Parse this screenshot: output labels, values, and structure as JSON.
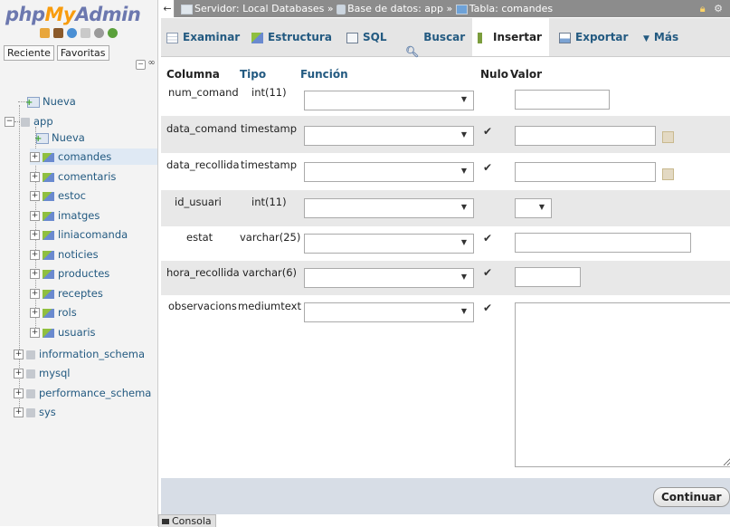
{
  "app": {
    "logo_php": "php",
    "logo_my": "My",
    "logo_admin": "Admin"
  },
  "sidebar": {
    "recent_tab": "Reciente",
    "favorites_tab": "Favoritas",
    "new_root": "Nueva",
    "databases": [
      {
        "name": "app",
        "expanded": true
      },
      {
        "name": "information_schema",
        "expanded": false
      },
      {
        "name": "mysql",
        "expanded": false
      },
      {
        "name": "performance_schema",
        "expanded": false
      },
      {
        "name": "sys",
        "expanded": false
      }
    ],
    "app_new": "Nueva",
    "tables": [
      "comandes",
      "comentaris",
      "estoc",
      "imatges",
      "liniacomanda",
      "noticies",
      "productes",
      "receptes",
      "rols",
      "usuaris"
    ],
    "selected_table": "comandes"
  },
  "breadcrumb": {
    "server_label": "Servidor:",
    "server_value": "Local Databases",
    "sep": "»",
    "db_label": "Base de datos:",
    "db_value": "app",
    "table_label": "Tabla:",
    "table_value": "comandes"
  },
  "tabs": [
    {
      "label": "Examinar",
      "icon": "browse-icon"
    },
    {
      "label": "Estructura",
      "icon": "structure-icon"
    },
    {
      "label": "SQL",
      "icon": "sql-icon"
    },
    {
      "label": "Buscar",
      "icon": "search-icon"
    },
    {
      "label": "Insertar",
      "icon": "insert-icon",
      "active": true
    },
    {
      "label": "Exportar",
      "icon": "export-icon"
    },
    {
      "label": "Más",
      "icon": "chevron-down-icon"
    }
  ],
  "form": {
    "headers": {
      "column": "Columna",
      "type": "Tipo",
      "function": "Función",
      "null": "Nulo",
      "value": "Valor"
    },
    "fields": [
      {
        "column": "num_comand",
        "type": "int(11)",
        "null_checked": false,
        "value": ""
      },
      {
        "column": "data_comand",
        "type": "timestamp",
        "null_checked": true,
        "value": ""
      },
      {
        "column": "data_recollida",
        "type": "timestamp",
        "null_checked": true,
        "value": ""
      },
      {
        "column": "id_usuari",
        "type": "int(11)",
        "null_checked": false,
        "value": ""
      },
      {
        "column": "estat",
        "type": "varchar(25)",
        "null_checked": true,
        "value": ""
      },
      {
        "column": "hora_recollida",
        "type": "varchar(6)",
        "null_checked": true,
        "value": ""
      },
      {
        "column": "observacions",
        "type": "mediumtext",
        "null_checked": true,
        "value": ""
      }
    ],
    "continue_button": "Continuar"
  },
  "console": {
    "label": "Consola"
  }
}
